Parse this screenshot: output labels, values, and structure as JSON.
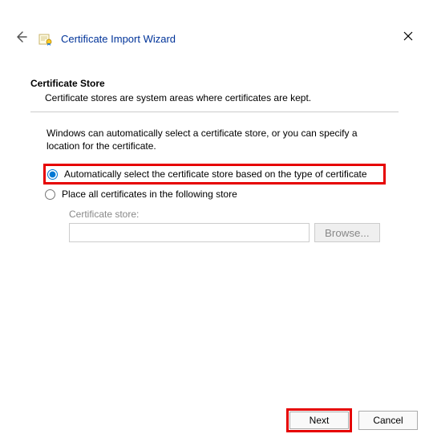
{
  "window": {
    "title": "Certificate Import Wizard"
  },
  "section": {
    "heading": "Certificate Store",
    "subtext": "Certificate stores are system areas where certificates are kept."
  },
  "description": "Windows can automatically select a certificate store, or you can specify a location for the certificate.",
  "options": {
    "auto": "Automatically select the certificate store based on the type of certificate",
    "manual": "Place all certificates in the following store"
  },
  "store": {
    "label": "Certificate store:",
    "value": "",
    "browse_label": "Browse..."
  },
  "footer": {
    "next": "Next",
    "cancel": "Cancel"
  }
}
